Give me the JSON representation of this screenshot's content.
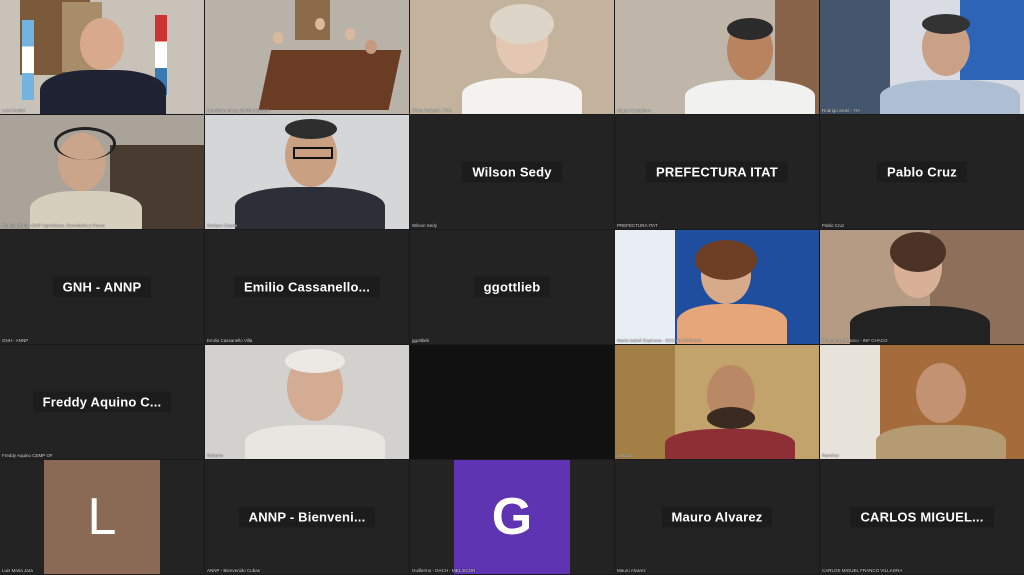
{
  "meeting": {
    "participants": [
      {
        "display": "",
        "caption": "Luis Paolini"
      },
      {
        "display": "",
        "caption": "Comisión Mixta del Río Paraná"
      },
      {
        "display": "",
        "caption": "Silvia Rafaelli - TNA"
      },
      {
        "display": "",
        "caption": "Miguel Caballero"
      },
      {
        "display": "",
        "caption": "Rodrigo Sedó - ITA"
      },
      {
        "display": "",
        "caption": "Daniela Rudio EMP Agricultura, Ganadería y Pesca"
      },
      {
        "display": "",
        "caption": "Enrique Duarte"
      },
      {
        "display": "Wilson Sedy",
        "caption": "Wilson Sedy"
      },
      {
        "display": "PREFECTURA ITAT",
        "caption": "PREFECTURA ITAT"
      },
      {
        "display": "Pablo Cruz",
        "caption": "Pablo Cruz"
      },
      {
        "display": "GNH - ANNP",
        "caption": "GNH - ANNP"
      },
      {
        "display": "Emilio  Cassanello...",
        "caption": "Emilio Cassanello Villa"
      },
      {
        "display": "ggottlieb",
        "caption": "ggottlieb"
      },
      {
        "display": "",
        "caption": "María Isabel Espinoza - ECOVIA PARANA"
      },
      {
        "display": "",
        "caption": "Constanza Franco - INF CHACO"
      },
      {
        "display": "Freddy  Aquino  C...",
        "caption": "Freddy Aquino CEMP OF"
      },
      {
        "display": "",
        "caption": "Roberto"
      },
      {
        "display": "",
        "caption": ""
      },
      {
        "display": "",
        "caption": "Leandro"
      },
      {
        "display": "",
        "caption": "Ramírez"
      },
      {
        "display": "",
        "caption": "Luis Maria Jara",
        "avatar_letter": "L"
      },
      {
        "display": "ANNP  -  Bienveni...",
        "caption": "ANNP - Bienvenido Cubas"
      },
      {
        "display": "",
        "caption": "Guillermo - DACH - MEL ECON",
        "avatar_letter": "G"
      },
      {
        "display": "Mauro Alvarez",
        "caption": "Mauro Alvarez"
      },
      {
        "display": "CARLOS  MIGUEL...",
        "caption": "CARLOS MIGUEL FRANCO VILLAGRA"
      }
    ],
    "colors": {
      "background": "#1a1a1a",
      "tile_empty": "#232323",
      "avatar_l": "#8b6a55",
      "avatar_g": "#5e34b3"
    }
  }
}
